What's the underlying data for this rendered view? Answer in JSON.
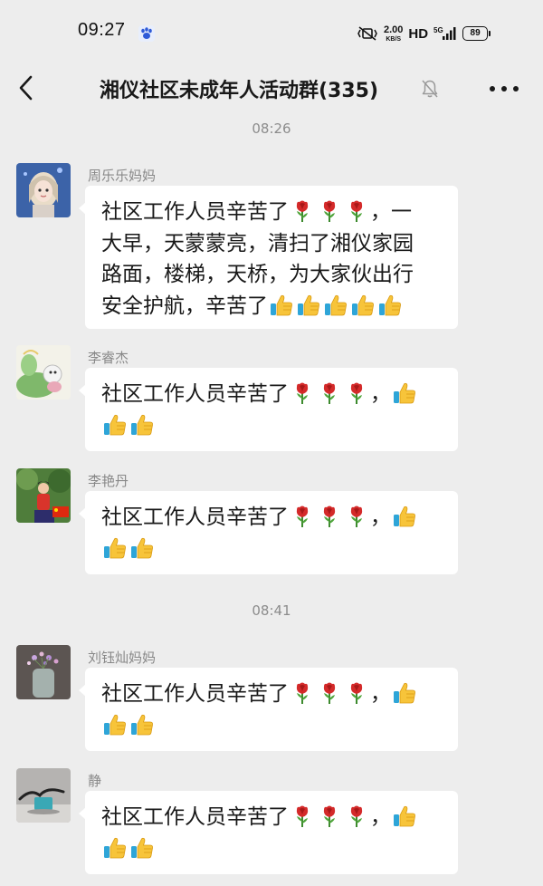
{
  "status_bar": {
    "time": "09:27",
    "net_speed_value": "2.00",
    "net_speed_unit": "KB/S",
    "hd_label": "HD",
    "network_type": "5G",
    "battery_level": "89"
  },
  "nav": {
    "title": "湘仪社区未成年人活动群(335)"
  },
  "timestamps": [
    "08:26",
    "08:41"
  ],
  "messages": [
    {
      "sender": "周乐乐妈妈",
      "lines": [
        "社区工作人员辛苦了{rose}{rose}{rose}，一",
        "大早，天蒙蒙亮，清扫了湘仪家园",
        "路面，楼梯，天桥，为大家伙出行",
        "安全护航，辛苦了{thumb}{thumb}{thumb}{thumb}{thumb}"
      ]
    },
    {
      "sender": "李睿杰",
      "lines": [
        "社区工作人员辛苦了{rose}{rose}{rose}，{thumb}",
        "{thumb}{thumb}"
      ]
    },
    {
      "sender": "李艳丹",
      "lines": [
        "社区工作人员辛苦了{rose}{rose}{rose}，{thumb}",
        "{thumb}{thumb}"
      ]
    },
    {
      "sender": "刘钰灿妈妈",
      "lines": [
        "社区工作人员辛苦了{rose}{rose}{rose}，{thumb}",
        "{thumb}{thumb}"
      ]
    },
    {
      "sender": "静",
      "lines": [
        "社区工作人员辛苦了{rose}{rose}{rose}，{thumb}",
        "{thumb}{thumb}"
      ]
    }
  ],
  "icons": {
    "back": "chevron-left-icon",
    "mute": "bell-off-icon",
    "more": "more-dots-icon",
    "rose_emoji": "rose-emoji-icon",
    "thumb_emoji": "thumbs-up-emoji-icon"
  }
}
